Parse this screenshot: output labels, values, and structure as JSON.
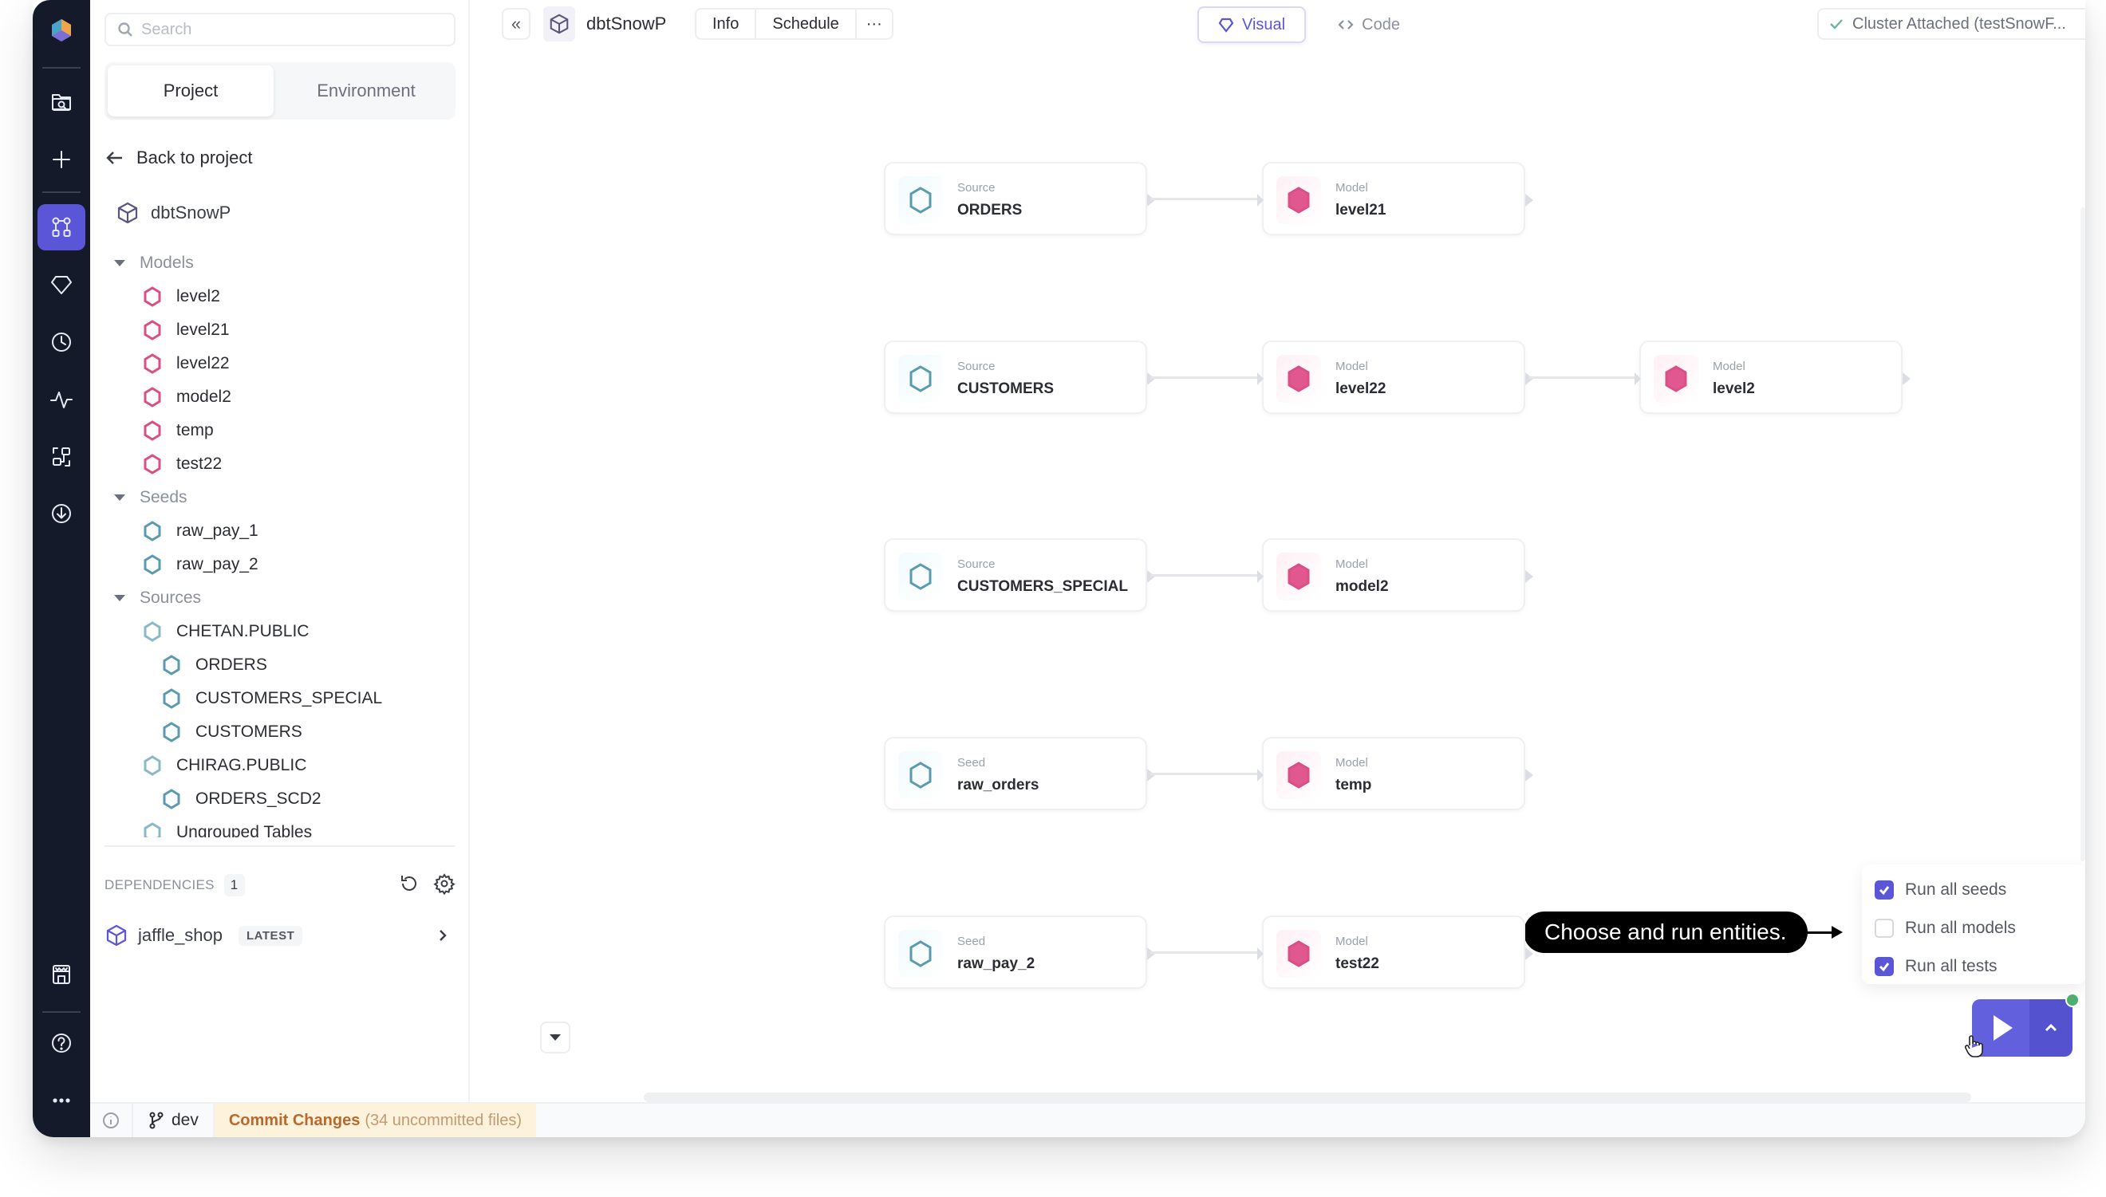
{
  "rail": {
    "items": [
      {
        "icon": "logo-icon"
      },
      {
        "icon": "folder-search-icon"
      },
      {
        "icon": "plus-icon"
      },
      {
        "icon": "graph-icon",
        "active": true
      },
      {
        "icon": "gem-icon"
      },
      {
        "icon": "clock-icon"
      },
      {
        "icon": "activity-icon"
      },
      {
        "icon": "lineage-icon"
      },
      {
        "icon": "download-icon"
      },
      {
        "icon": "marketplace-icon"
      },
      {
        "icon": "help-icon"
      },
      {
        "icon": "more-icon"
      }
    ]
  },
  "sidebar": {
    "search_placeholder": "Search",
    "tabs": [
      {
        "label": "Project",
        "active": true
      },
      {
        "label": "Environment",
        "active": false
      }
    ],
    "back_label": "Back to project",
    "project_name": "dbtSnowP",
    "tree": {
      "models": {
        "label": "Models",
        "items": [
          "level2",
          "level21",
          "level22",
          "model2",
          "temp",
          "test22"
        ]
      },
      "seeds": {
        "label": "Seeds",
        "items": [
          "raw_pay_1",
          "raw_pay_2"
        ]
      },
      "sources": {
        "label": "Sources",
        "groups": [
          {
            "label": "CHETAN.PUBLIC",
            "items": [
              "ORDERS",
              "CUSTOMERS_SPECIAL",
              "CUSTOMERS"
            ]
          },
          {
            "label": "CHIRAG.PUBLIC",
            "items": [
              "ORDERS_SCD2"
            ]
          },
          {
            "label": "Ungrouped Tables",
            "items": []
          }
        ]
      }
    },
    "dependencies": {
      "label": "DEPENDENCIES",
      "count": "1",
      "items": [
        {
          "name": "jaffle_shop",
          "badge": "LATEST"
        }
      ]
    }
  },
  "topbar": {
    "collapse_label": "«",
    "project_name": "dbtSnowP",
    "info_label": "Info",
    "schedule_label": "Schedule",
    "more_label": "···",
    "view_visual": "Visual",
    "view_code": "Code",
    "cluster_label": "Cluster Attached (testSnowF..."
  },
  "canvas": {
    "rows": [
      {
        "nodes": [
          {
            "kind": "Source",
            "name": "ORDERS",
            "type": "source"
          },
          {
            "kind": "Model",
            "name": "level21",
            "type": "model"
          }
        ]
      },
      {
        "nodes": [
          {
            "kind": "Source",
            "name": "CUSTOMERS",
            "type": "source"
          },
          {
            "kind": "Model",
            "name": "level22",
            "type": "model"
          },
          {
            "kind": "Model",
            "name": "level2",
            "type": "model"
          }
        ]
      },
      {
        "nodes": [
          {
            "kind": "Source",
            "name": "CUSTOMERS_SPECIAL",
            "type": "source"
          },
          {
            "kind": "Model",
            "name": "model2",
            "type": "model"
          }
        ]
      },
      {
        "nodes": [
          {
            "kind": "Seed",
            "name": "raw_orders",
            "type": "source"
          },
          {
            "kind": "Model",
            "name": "temp",
            "type": "model"
          }
        ]
      },
      {
        "nodes": [
          {
            "kind": "Seed",
            "name": "raw_pay_2",
            "type": "source"
          },
          {
            "kind": "Model",
            "name": "test22",
            "type": "model"
          }
        ]
      }
    ],
    "run_menu": [
      {
        "label": "Run all seeds",
        "checked": true
      },
      {
        "label": "Run all models",
        "checked": false
      },
      {
        "label": "Run all tests",
        "checked": true
      }
    ],
    "callout": "Choose and run entities."
  },
  "statusbar": {
    "branch": "dev",
    "commit_label": "Commit Changes",
    "commit_detail": "(34 uncommitted files)"
  },
  "colors": {
    "accent": "#5b55d8",
    "rail_bg": "#151a2b",
    "model": "#d94f86",
    "source": "#5a9bb0",
    "commit_bg": "#fdf2dc",
    "commit_text": "#b8692d",
    "status_ok": "#4caf6e"
  }
}
